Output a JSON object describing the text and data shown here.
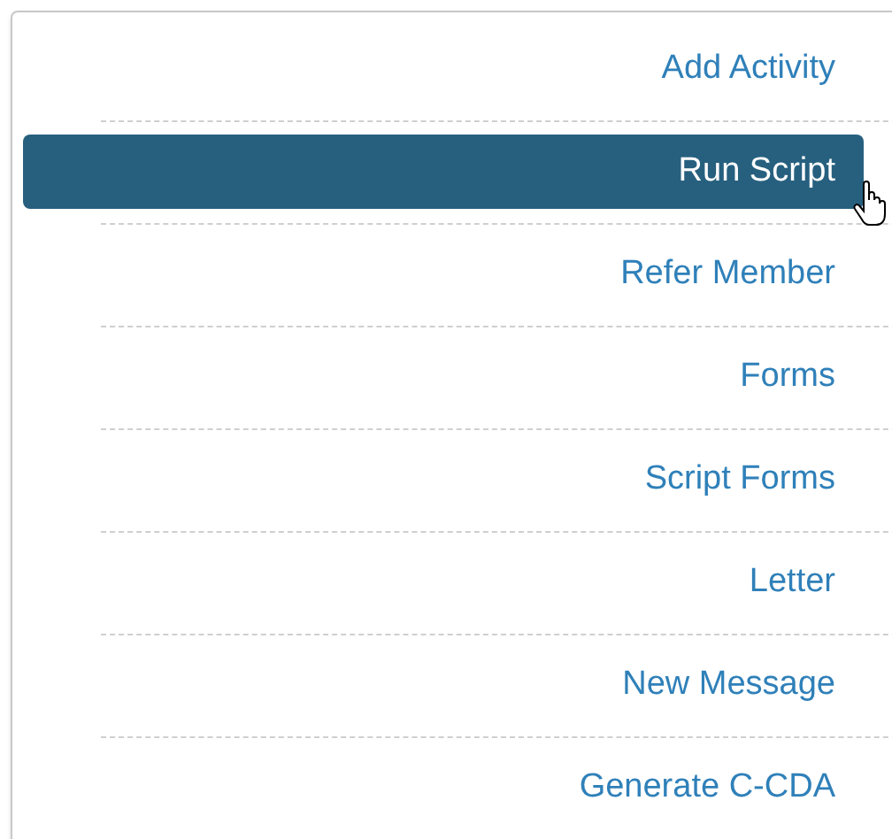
{
  "menu": {
    "items": [
      {
        "label": "Add Activity",
        "selected": false
      },
      {
        "label": "Run Script",
        "selected": true
      },
      {
        "label": "Refer Member",
        "selected": false
      },
      {
        "label": "Forms",
        "selected": false
      },
      {
        "label": "Script Forms",
        "selected": false
      },
      {
        "label": "Letter",
        "selected": false
      },
      {
        "label": "New Message",
        "selected": false
      },
      {
        "label": "Generate C-CDA",
        "selected": false
      }
    ]
  }
}
